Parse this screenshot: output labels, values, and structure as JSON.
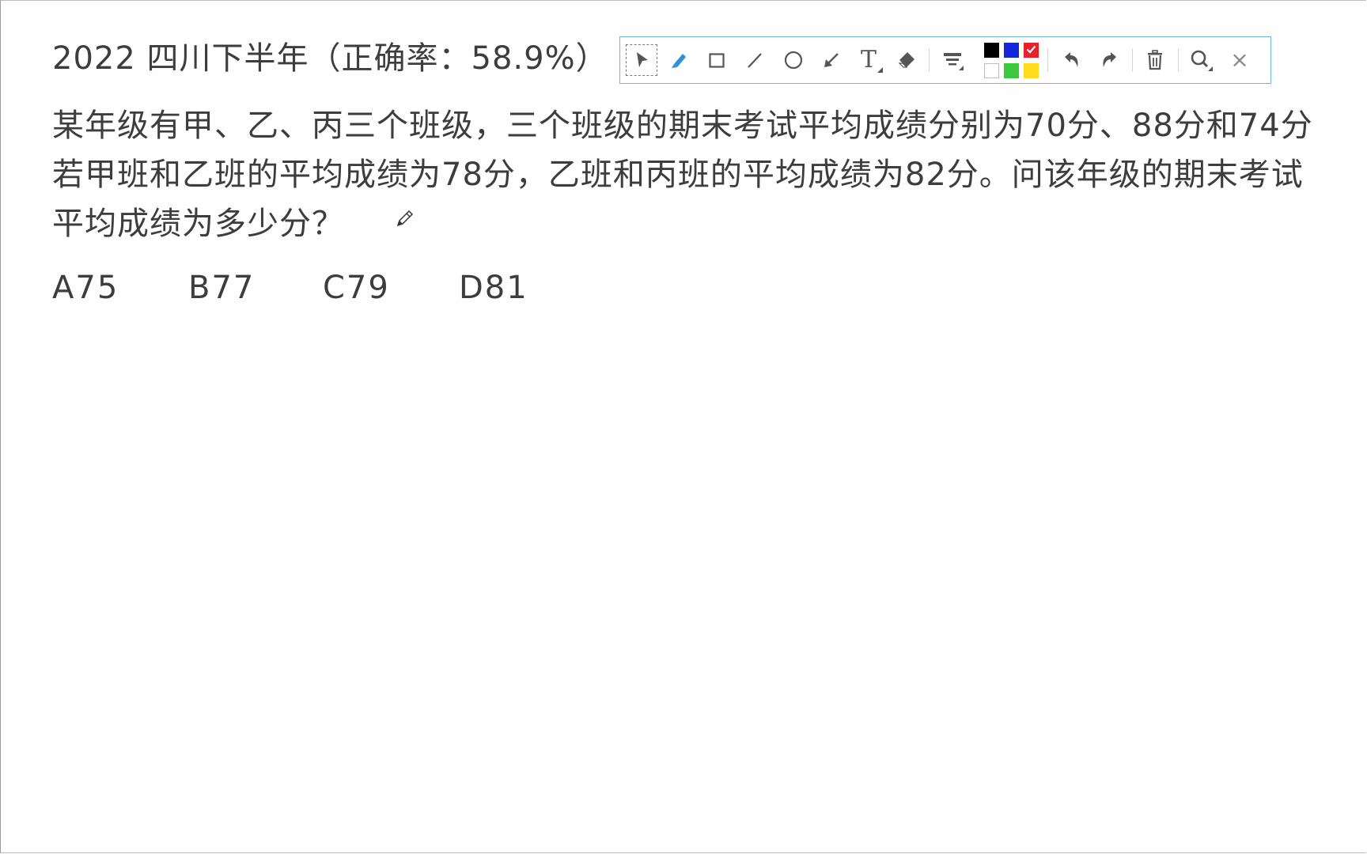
{
  "title": "2022 四川下半年（正确率：58.9%）",
  "question": {
    "line1": "某年级有甲、乙、丙三个班级，三个班级的期末考试平均成绩分别为70分、88分和74分",
    "line2": "若甲班和乙班的平均成绩为78分，乙班和丙班的平均成绩为82分。问该年级的期末考试",
    "line3": "平均成绩为多少分？"
  },
  "options": [
    {
      "label": "A75"
    },
    {
      "label": "B77"
    },
    {
      "label": "C79"
    },
    {
      "label": "D81"
    }
  ],
  "toolbar": {
    "tools": [
      {
        "icon": "select-arrow-icon",
        "selected": true
      },
      {
        "icon": "pen-icon"
      },
      {
        "icon": "rectangle-icon"
      },
      {
        "icon": "line-icon"
      },
      {
        "icon": "circle-icon"
      },
      {
        "icon": "arrow-icon"
      },
      {
        "icon": "text-icon",
        "glyph": "T"
      },
      {
        "icon": "eraser-icon"
      },
      {
        "icon": "line-width-icon"
      },
      {
        "icon": "undo-icon"
      },
      {
        "icon": "redo-icon"
      },
      {
        "icon": "delete-icon"
      },
      {
        "icon": "zoom-icon"
      },
      {
        "icon": "close-icon",
        "glyph": "×"
      }
    ],
    "colors": [
      {
        "name": "black",
        "hex": "#000000"
      },
      {
        "name": "blue",
        "hex": "#1428d8"
      },
      {
        "name": "red",
        "hex": "#e8202a",
        "selected": true
      },
      {
        "name": "white",
        "hex": "#ffffff"
      },
      {
        "name": "green",
        "hex": "#3cc83c"
      },
      {
        "name": "yellow",
        "hex": "#ffdc1e"
      }
    ],
    "accent_color": "#2f8fd8",
    "border_color": "#6fb5d8"
  }
}
